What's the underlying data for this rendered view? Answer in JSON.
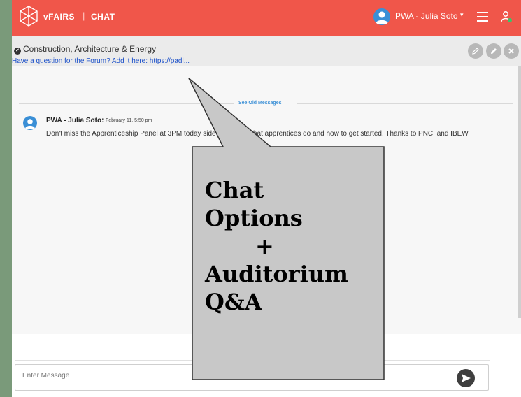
{
  "header": {
    "brand": "vFAIRS",
    "separator": "|",
    "section": "CHAT",
    "user_name": "PWA - Julia Soto",
    "caret": "▾",
    "accent_color": "#f0564a"
  },
  "room": {
    "title": "Construction, Architecture & Energy",
    "check_glyph": "✔",
    "link_text": "Have a question for the Forum? Add it here: https://padl...",
    "actions": [
      "pencil-icon",
      "edit-icon",
      "close-icon"
    ]
  },
  "messages": {
    "see_old_label": "See Old Messages",
    "items": [
      {
        "author": "PWA - Julia Soto:",
        "time": "February 11, 5:50 pm",
        "text": "Don't miss the Apprenticeship Panel at 3PM today side scoop on what apprentices do and how to get started. Thanks to PNCI and IBEW."
      }
    ]
  },
  "composer": {
    "placeholder": "Enter Message"
  },
  "callout": {
    "line1": "Chat",
    "line2": "Options",
    "line3": "+",
    "line4": "Auditorium",
    "line5": "Q&A",
    "fill_color": "#c8c8c8"
  }
}
